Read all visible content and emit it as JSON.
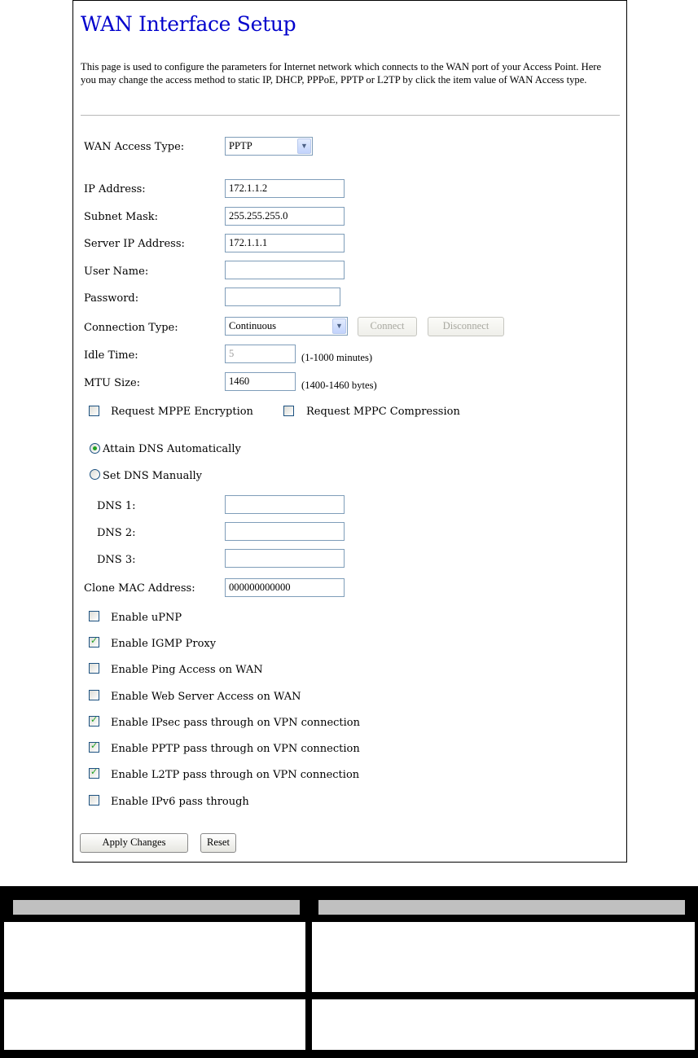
{
  "page": {
    "title": "WAN Interface Setup",
    "intro": "This page is used to configure the parameters for Internet network which connects to the WAN port of your Access Point. Here you may change the access method to static IP, DHCP, PPPoE, PPTP or L2TP by click the item value of WAN Access type."
  },
  "form": {
    "wan_access_type": {
      "label": "WAN Access Type:",
      "value": "PPTP"
    },
    "ip_address": {
      "label": "IP Address:",
      "value": "172.1.1.2"
    },
    "subnet_mask": {
      "label": "Subnet Mask:",
      "value": "255.255.255.0"
    },
    "server_ip": {
      "label": "Server IP Address:",
      "value": "172.1.1.1"
    },
    "user_name": {
      "label": "User Name:",
      "value": ""
    },
    "password": {
      "label": "Password:",
      "value": ""
    },
    "connection_type": {
      "label": "Connection Type:",
      "value": "Continuous",
      "connect_label": "Connect",
      "disconnect_label": "Disconnect"
    },
    "idle_time": {
      "label": "Idle Time:",
      "value": "5",
      "unit": "(1-1000 minutes)"
    },
    "mtu_size": {
      "label": "MTU Size:",
      "value": "1460",
      "unit": "(1400-1460 bytes)"
    },
    "mppe": {
      "label": "Request MPPE Encryption",
      "checked": false
    },
    "mppc": {
      "label": "Request MPPC Compression",
      "checked": false
    },
    "dns_auto": {
      "label": "Attain DNS Automatically",
      "checked": true
    },
    "dns_manual": {
      "label": "Set DNS Manually",
      "checked": false
    },
    "dns1": {
      "label": "DNS 1:",
      "value": ""
    },
    "dns2": {
      "label": "DNS 2:",
      "value": ""
    },
    "dns3": {
      "label": "DNS 3:",
      "value": ""
    },
    "clone_mac": {
      "label": "Clone MAC Address:",
      "value": "000000000000"
    },
    "options": [
      {
        "label": "Enable uPNP",
        "checked": false
      },
      {
        "label": "Enable IGMP Proxy",
        "checked": true
      },
      {
        "label": "Enable Ping Access on WAN",
        "checked": false
      },
      {
        "label": "Enable Web Server Access on WAN",
        "checked": false
      },
      {
        "label": "Enable IPsec pass through on VPN connection",
        "checked": true
      },
      {
        "label": "Enable PPTP pass through on VPN connection",
        "checked": true
      },
      {
        "label": "Enable L2TP pass through on VPN connection",
        "checked": true
      },
      {
        "label": "Enable IPv6 pass through",
        "checked": false
      }
    ],
    "apply_label": "Apply Changes",
    "reset_label": "Reset"
  },
  "colors": {
    "title": "#0000cc",
    "check_mark": "#21a121",
    "table_header": "#c0c0c0"
  }
}
